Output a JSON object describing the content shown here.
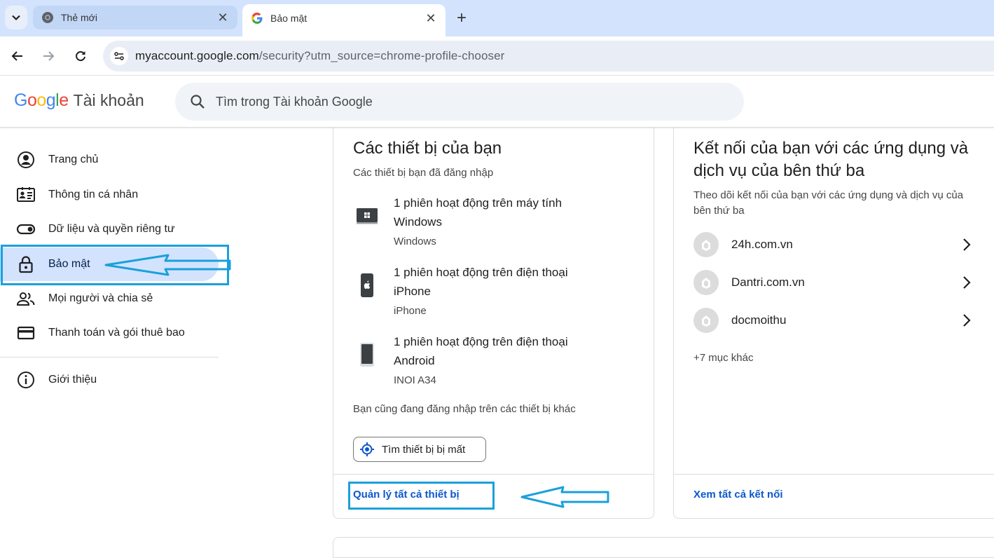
{
  "browser": {
    "tabs": [
      {
        "title": "Thẻ mới",
        "favicon": "chrome-icon",
        "active": false
      },
      {
        "title": "Bảo mật",
        "favicon": "google-g-icon",
        "active": true
      }
    ],
    "url_host": "myaccount.google.com",
    "url_rest": "/security?utm_source=chrome-profile-chooser"
  },
  "header": {
    "logo": "Google",
    "product": "Tài khoản",
    "search_placeholder": "Tìm trong Tài khoản Google"
  },
  "sidebar": {
    "items": [
      {
        "label": "Trang chủ",
        "icon": "account-circle-icon"
      },
      {
        "label": "Thông tin cá nhân",
        "icon": "id-card-icon"
      },
      {
        "label": "Dữ liệu và quyền riêng tư",
        "icon": "toggle-icon"
      },
      {
        "label": "Bảo mật",
        "icon": "lock-icon",
        "selected": true
      },
      {
        "label": "Mọi người và chia sẻ",
        "icon": "people-icon"
      },
      {
        "label": "Thanh toán và gói thuê bao",
        "icon": "credit-card-icon"
      },
      {
        "label": "Giới thiệu",
        "icon": "info-icon"
      }
    ]
  },
  "devices_card": {
    "title": "Các thiết bị của bạn",
    "subtitle": "Các thiết bị bạn đã đăng nhập",
    "devices": [
      {
        "title": "1 phiên hoạt động trên máy tính Windows",
        "detail": "Windows",
        "icon": "windows-laptop-icon"
      },
      {
        "title": "1 phiên hoạt động trên điện thoại iPhone",
        "detail": "iPhone",
        "icon": "iphone-icon"
      },
      {
        "title": "1 phiên hoạt động trên điện thoại Android",
        "detail": "INOI A34",
        "icon": "android-phone-icon"
      }
    ],
    "other_note": "Bạn cũng đang đăng nhập trên các thiết bị khác",
    "find_button": "Tìm thiết bị bị mất",
    "manage_link": "Quản lý tất cả thiết bị"
  },
  "connections_card": {
    "title": "Kết nối của bạn với các ứng dụng và dịch vụ của bên thứ ba",
    "subtitle": "Theo dõi kết nối của bạn với các ứng dụng và dịch vụ của bên thứ ba",
    "items": [
      {
        "label": "24h.com.vn"
      },
      {
        "label": "Dantri.com.vn"
      },
      {
        "label": "docmoithu"
      }
    ],
    "more": "+7 mục khác",
    "see_all_link": "Xem tất cả kết nối"
  },
  "colors": {
    "accent": "#0b57d0",
    "selected_bg": "#d3e3fd",
    "annotation": "#1aa0dc"
  }
}
